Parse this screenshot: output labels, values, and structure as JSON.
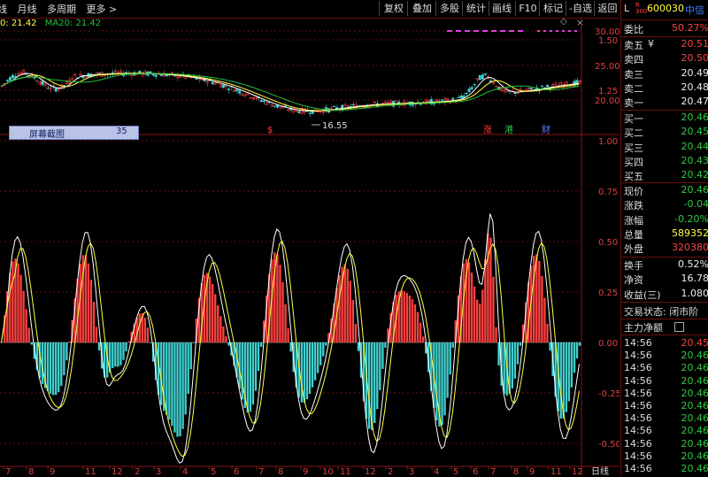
{
  "toolbar": {
    "left_items": [
      "日线",
      "月线",
      "多周期",
      "更多 >"
    ],
    "buttons": [
      "复权",
      "叠加",
      "多股",
      "统计",
      "画线",
      "F10",
      "标记",
      "-自选",
      "返回"
    ],
    "diamond": "◇",
    "close": "×"
  },
  "ma_legend": {
    "prefix": "0: 21.42",
    "ma20": "MA20: 21.42"
  },
  "price_axis": [
    "30.00",
    "25.00",
    "20.00"
  ],
  "indicator_axis": [
    "1.50",
    "1.25",
    "1.00",
    "0.75",
    "0.50",
    "0.25",
    "0.00",
    "-0.25",
    "-0.50"
  ],
  "x_axis": {
    "labels": [
      "7",
      "8",
      "9",
      "11",
      "12",
      "2",
      "3",
      "4",
      "5",
      "6",
      "7",
      "8",
      "9",
      "10",
      "11",
      "12",
      "2",
      "3",
      "4",
      "5",
      "6",
      "7",
      "8",
      "9",
      "11",
      "12"
    ],
    "period_label": "日线"
  },
  "annotations": {
    "low_price": "16.55",
    "screenshot_label": "屏幕截图",
    "screenshot_num": "35",
    "marks": [
      "$",
      "涨",
      "港",
      "财"
    ]
  },
  "sidebar": {
    "header": {
      "prefix": "L",
      "tag": "R\n300",
      "code": "600030",
      "name": "中信"
    },
    "ratio": {
      "label": "委比",
      "value": "50.27%"
    },
    "asks": [
      {
        "label": "卖五",
        "extra": "¥",
        "value": "20.51"
      },
      {
        "label": "卖四",
        "value": "20.50"
      },
      {
        "label": "卖三",
        "value": "20.49"
      },
      {
        "label": "卖二",
        "value": "20.48"
      },
      {
        "label": "卖一",
        "value": "20.47"
      }
    ],
    "bids": [
      {
        "label": "买一",
        "value": "20.46"
      },
      {
        "label": "买二",
        "value": "20.45"
      },
      {
        "label": "买三",
        "value": "20.44"
      },
      {
        "label": "买四",
        "value": "20.43"
      },
      {
        "label": "买五",
        "value": "20.42"
      }
    ],
    "stats": [
      {
        "label": "现价",
        "value": "20.46",
        "color": "green"
      },
      {
        "label": "涨跌",
        "value": "-0.04",
        "color": "green"
      },
      {
        "label": "涨幅",
        "value": "-0.20%",
        "color": "green"
      },
      {
        "label": "总量",
        "value": "589352",
        "color": "yellow"
      },
      {
        "label": "外盘",
        "value": "320380",
        "color": "red"
      }
    ],
    "stats2": [
      {
        "label": "换手",
        "value": "0.52%",
        "color": "white"
      },
      {
        "label": "净资",
        "value": "16.78",
        "color": "white"
      },
      {
        "label": "收益(三)",
        "value": "1.080",
        "color": "white"
      }
    ],
    "trade_status": "交易状态: 闭市阶",
    "main_flow": "主力净额",
    "ticks": [
      {
        "time": "14:56",
        "price": "20.45"
      },
      {
        "time": "14:56",
        "price": "20.46"
      },
      {
        "time": "14:56",
        "price": "20.46"
      },
      {
        "time": "14:56",
        "price": "20.46"
      },
      {
        "time": "14:56",
        "price": "20.46"
      },
      {
        "time": "14:56",
        "price": "20.46"
      },
      {
        "time": "14:56",
        "price": "20.46"
      },
      {
        "time": "14:56",
        "price": "20.46"
      },
      {
        "time": "14:56",
        "price": "20.46"
      },
      {
        "time": "14:56",
        "price": "20.46"
      },
      {
        "time": "14:56",
        "price": "20.46"
      }
    ]
  },
  "colors": {
    "up": "#ff4040",
    "down": "#40d0d0",
    "ma_white": "#ffffff",
    "ma_yellow": "#ffff40",
    "ma_green": "#20c040",
    "grid": "#8a1515"
  }
}
